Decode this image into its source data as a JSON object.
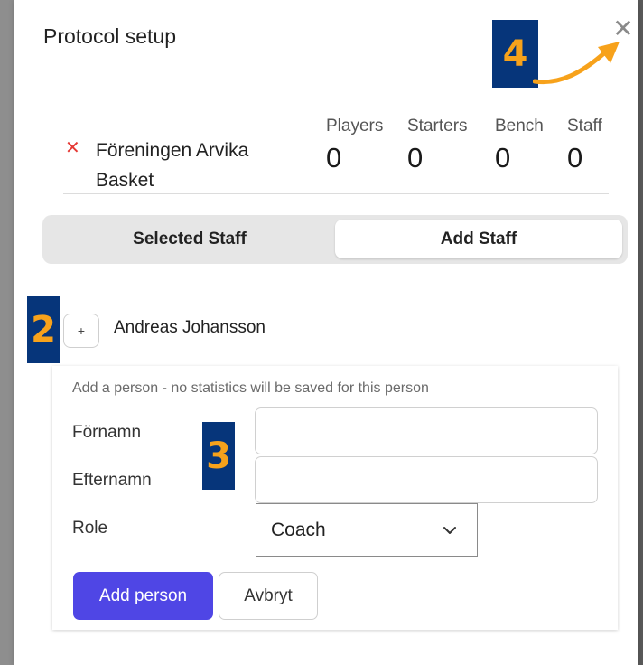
{
  "dialog": {
    "title": "Protocol setup",
    "close_icon": "close-icon"
  },
  "annotations": {
    "badge4": "4",
    "badge2": "2",
    "badge3": "3",
    "accent": "#f7a21b",
    "badge_bg": "#06357a"
  },
  "team": {
    "remove_icon": "x-icon",
    "name": "Föreningen Arvika Basket",
    "stats": [
      {
        "label": "Players",
        "value": "0"
      },
      {
        "label": "Starters",
        "value": "0"
      },
      {
        "label": "Bench",
        "value": "0"
      },
      {
        "label": "Staff",
        "value": "0"
      }
    ]
  },
  "tabs": [
    {
      "label": "Selected Staff",
      "active": false
    },
    {
      "label": "Add Staff",
      "active": true
    }
  ],
  "staff_list": [
    {
      "add_label": "+",
      "name": "Andreas Johansson"
    }
  ],
  "form": {
    "hint": "Add a person - no statistics will be saved for this person",
    "first_name_label": "Förnamn",
    "first_name_value": "",
    "last_name_label": "Efternamn",
    "last_name_value": "",
    "role_label": "Role",
    "role_value": "Coach",
    "submit_label": "Add person",
    "cancel_label": "Avbryt",
    "primary_color": "#4f46e5"
  }
}
